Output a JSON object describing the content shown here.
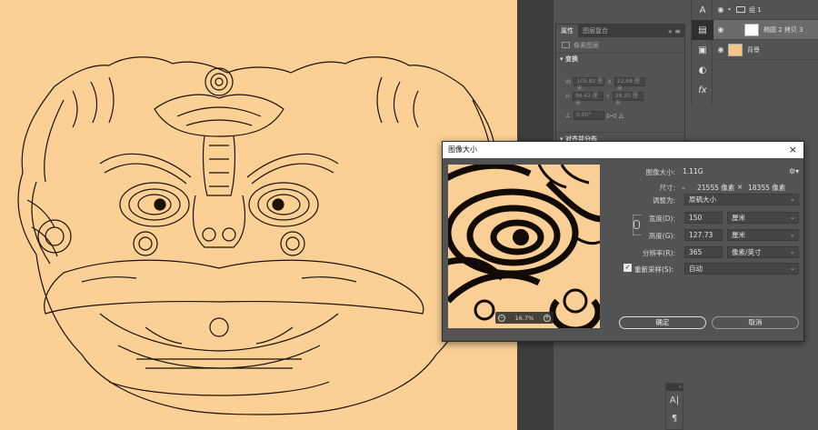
{
  "properties_panel": {
    "tabs": [
      "属性",
      "图层复合"
    ],
    "collapse_icon": "double-chevron-icon",
    "pixel_layer_label": "像素图层",
    "transform_heading": "变换",
    "w_label": "W",
    "w_value": "105.82 厘米",
    "x_label": "X",
    "x_value": "22.68 厘米",
    "h_label": "H",
    "h_value": "96.42 厘米",
    "y_label": "Y",
    "y_value": "26.35 厘米",
    "angle_value": "0.00°",
    "align_heading": "对齐并分布"
  },
  "layers": [
    {
      "name": "组 1",
      "type": "group",
      "visible": true
    },
    {
      "name": "椭圆 2 拷贝 3",
      "type": "layer",
      "visible": true,
      "selected": true
    },
    {
      "name": "背景",
      "type": "layer",
      "visible": true
    }
  ],
  "tool_icons": [
    "character-icon",
    "paragraph-icon",
    "properties-icon",
    "libraries-icon",
    "adjustments-icon",
    "fx-icon"
  ],
  "dialog": {
    "title": "图像大小",
    "close_icon": "×",
    "image_size_label": "图像大小:",
    "image_size_value": "1.11G",
    "dimensions_label": "尺寸:",
    "dimensions_w": "21555 像素",
    "dimensions_x": "×",
    "dimensions_h": "18355 像素",
    "fit_to_label": "调整为:",
    "fit_to_value": "原稿大小",
    "width_label": "宽度(D):",
    "width_value": "150",
    "width_unit": "厘米",
    "height_label": "高度(G):",
    "height_value": "127.73",
    "height_unit": "厘米",
    "resolution_label": "分辨率(R):",
    "resolution_value": "365",
    "resolution_unit": "像素/英寸",
    "resample_label": "重新采样(S):",
    "resample_checked": true,
    "resample_value": "自动",
    "zoom_value": "16.7%",
    "ok_label": "确定",
    "cancel_label": "取消"
  },
  "mini_panel": {
    "icons": [
      "character-icon",
      "paragraph-icon"
    ]
  },
  "colors": {
    "canvas_bg": "#fbd095",
    "panel_bg": "#535353",
    "line_art": "#1a1208"
  }
}
